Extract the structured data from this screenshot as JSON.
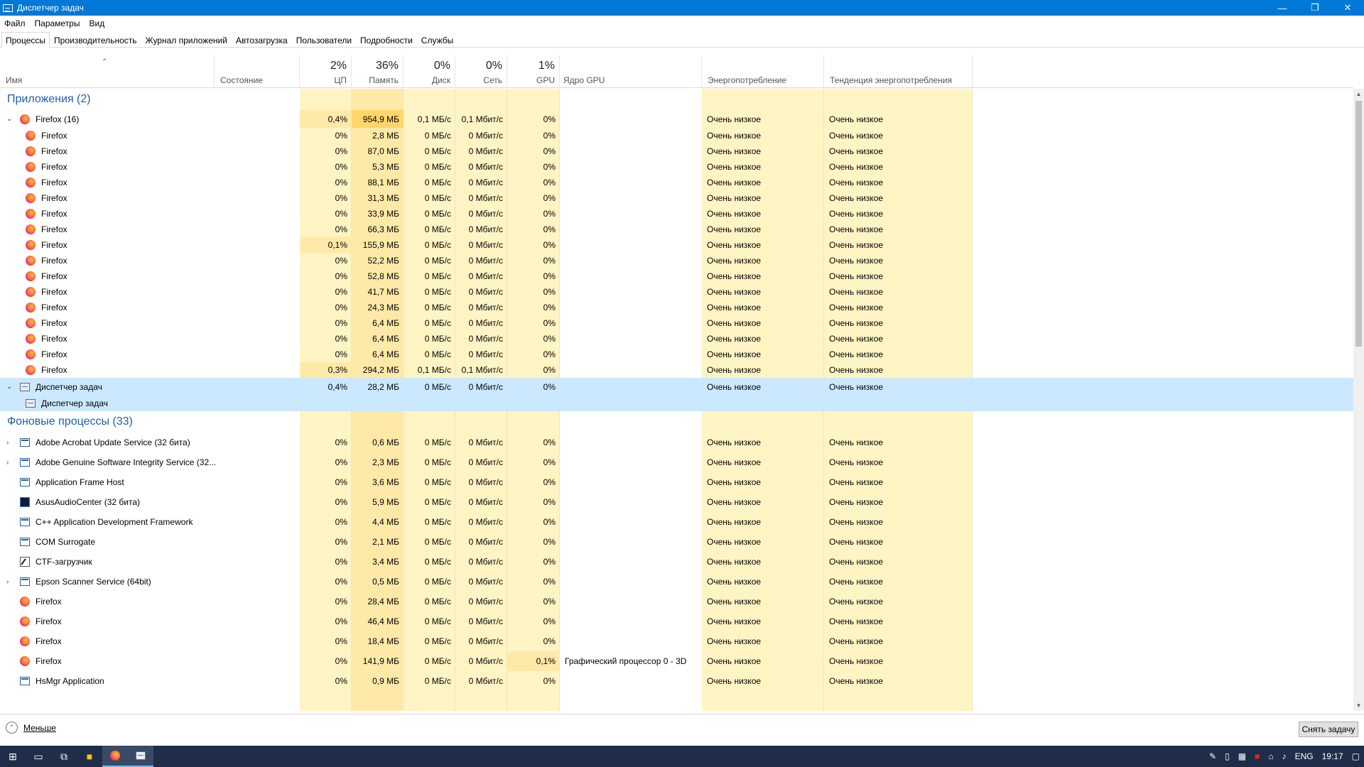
{
  "window": {
    "title": "Диспетчер задач"
  },
  "window_controls": {
    "minimize": "—",
    "restore": "❐",
    "close": "✕"
  },
  "menu": [
    "Файл",
    "Параметры",
    "Вид"
  ],
  "tabs": [
    "Процессы",
    "Производительность",
    "Журнал приложений",
    "Автозагрузка",
    "Пользователи",
    "Подробности",
    "Службы"
  ],
  "active_tab": 0,
  "columns": {
    "name": "Имя",
    "status": "Состояние",
    "cpu": {
      "pct": "2%",
      "label": "ЦП"
    },
    "memory": {
      "pct": "36%",
      "label": "Память"
    },
    "disk": {
      "pct": "0%",
      "label": "Диск"
    },
    "network": {
      "pct": "0%",
      "label": "Сеть"
    },
    "gpu": {
      "pct": "1%",
      "label": "GPU"
    },
    "gpu_engine": "Ядро GPU",
    "power": "Энергопотребление",
    "power_trend": "Тенденция энергопотребления"
  },
  "groups": {
    "apps": "Приложения (2)",
    "background": "Фоновые процессы (33)"
  },
  "rows": [
    {
      "kind": "group",
      "label": "Приложения (2)"
    },
    {
      "kind": "parent",
      "expander": "⌄",
      "icon": "firefox-icon",
      "name": "Firefox (16)",
      "cpu": "0,4%",
      "mem": "954,9 МБ",
      "disk": "0,1 МБ/с",
      "net": "0,1 Мбит/с",
      "gpu": "0%",
      "engine": "",
      "power": "Очень низкое",
      "trend": "Очень низкое",
      "memhl": "strong"
    },
    {
      "kind": "child",
      "icon": "firefox-icon",
      "name": "Firefox",
      "cpu": "0%",
      "mem": "2,8 МБ",
      "disk": "0 МБ/с",
      "net": "0 Мбит/с",
      "gpu": "0%",
      "engine": "",
      "power": "Очень низкое",
      "trend": "Очень низкое"
    },
    {
      "kind": "child",
      "icon": "firefox-icon",
      "name": "Firefox",
      "cpu": "0%",
      "mem": "87,0 МБ",
      "disk": "0 МБ/с",
      "net": "0 Мбит/с",
      "gpu": "0%",
      "engine": "",
      "power": "Очень низкое",
      "trend": "Очень низкое"
    },
    {
      "kind": "child",
      "icon": "firefox-icon",
      "name": "Firefox",
      "cpu": "0%",
      "mem": "5,3 МБ",
      "disk": "0 МБ/с",
      "net": "0 Мбит/с",
      "gpu": "0%",
      "engine": "",
      "power": "Очень низкое",
      "trend": "Очень низкое"
    },
    {
      "kind": "child",
      "icon": "firefox-icon",
      "name": "Firefox",
      "cpu": "0%",
      "mem": "88,1 МБ",
      "disk": "0 МБ/с",
      "net": "0 Мбит/с",
      "gpu": "0%",
      "engine": "",
      "power": "Очень низкое",
      "trend": "Очень низкое"
    },
    {
      "kind": "child",
      "icon": "firefox-icon",
      "name": "Firefox",
      "cpu": "0%",
      "mem": "31,3 МБ",
      "disk": "0 МБ/с",
      "net": "0 Мбит/с",
      "gpu": "0%",
      "engine": "",
      "power": "Очень низкое",
      "trend": "Очень низкое"
    },
    {
      "kind": "child",
      "icon": "firefox-icon",
      "name": "Firefox",
      "cpu": "0%",
      "mem": "33,9 МБ",
      "disk": "0 МБ/с",
      "net": "0 Мбит/с",
      "gpu": "0%",
      "engine": "",
      "power": "Очень низкое",
      "trend": "Очень низкое"
    },
    {
      "kind": "child",
      "icon": "firefox-icon",
      "name": "Firefox",
      "cpu": "0%",
      "mem": "66,3 МБ",
      "disk": "0 МБ/с",
      "net": "0 Мбит/с",
      "gpu": "0%",
      "engine": "",
      "power": "Очень низкое",
      "trend": "Очень низкое"
    },
    {
      "kind": "child",
      "icon": "firefox-icon",
      "name": "Firefox",
      "cpu": "0,1%",
      "mem": "155,9 МБ",
      "disk": "0 МБ/с",
      "net": "0 Мбит/с",
      "gpu": "0%",
      "engine": "",
      "power": "Очень низкое",
      "trend": "Очень низкое",
      "cpuhl": "mid"
    },
    {
      "kind": "child",
      "icon": "firefox-icon",
      "name": "Firefox",
      "cpu": "0%",
      "mem": "52,2 МБ",
      "disk": "0 МБ/с",
      "net": "0 Мбит/с",
      "gpu": "0%",
      "engine": "",
      "power": "Очень низкое",
      "trend": "Очень низкое"
    },
    {
      "kind": "child",
      "icon": "firefox-icon",
      "name": "Firefox",
      "cpu": "0%",
      "mem": "52,8 МБ",
      "disk": "0 МБ/с",
      "net": "0 Мбит/с",
      "gpu": "0%",
      "engine": "",
      "power": "Очень низкое",
      "trend": "Очень низкое"
    },
    {
      "kind": "child",
      "icon": "firefox-icon",
      "name": "Firefox",
      "cpu": "0%",
      "mem": "41,7 МБ",
      "disk": "0 МБ/с",
      "net": "0 Мбит/с",
      "gpu": "0%",
      "engine": "",
      "power": "Очень низкое",
      "trend": "Очень низкое"
    },
    {
      "kind": "child",
      "icon": "firefox-icon",
      "name": "Firefox",
      "cpu": "0%",
      "mem": "24,3 МБ",
      "disk": "0 МБ/с",
      "net": "0 Мбит/с",
      "gpu": "0%",
      "engine": "",
      "power": "Очень низкое",
      "trend": "Очень низкое"
    },
    {
      "kind": "child",
      "icon": "firefox-icon",
      "name": "Firefox",
      "cpu": "0%",
      "mem": "6,4 МБ",
      "disk": "0 МБ/с",
      "net": "0 Мбит/с",
      "gpu": "0%",
      "engine": "",
      "power": "Очень низкое",
      "trend": "Очень низкое"
    },
    {
      "kind": "child",
      "icon": "firefox-icon",
      "name": "Firefox",
      "cpu": "0%",
      "mem": "6,4 МБ",
      "disk": "0 МБ/с",
      "net": "0 Мбит/с",
      "gpu": "0%",
      "engine": "",
      "power": "Очень низкое",
      "trend": "Очень низкое"
    },
    {
      "kind": "child",
      "icon": "firefox-icon",
      "name": "Firefox",
      "cpu": "0%",
      "mem": "6,4 МБ",
      "disk": "0 МБ/с",
      "net": "0 Мбит/с",
      "gpu": "0%",
      "engine": "",
      "power": "Очень низкое",
      "trend": "Очень низкое"
    },
    {
      "kind": "child",
      "icon": "firefox-icon",
      "name": "Firefox",
      "cpu": "0,3%",
      "mem": "294,2 МБ",
      "disk": "0,1 МБ/с",
      "net": "0,1 Мбит/с",
      "gpu": "0%",
      "engine": "",
      "power": "Очень низкое",
      "trend": "Очень низкое",
      "cpuhl": "mid"
    },
    {
      "kind": "parent",
      "selected": true,
      "expander": "⌄",
      "icon": "taskmgr-icon",
      "name": "Диспетчер задач",
      "cpu": "0,4%",
      "mem": "28,2 МБ",
      "disk": "0 МБ/с",
      "net": "0 Мбит/с",
      "gpu": "0%",
      "engine": "",
      "power": "Очень низкое",
      "trend": "Очень низкое"
    },
    {
      "kind": "child",
      "selected": true,
      "icon": "taskmgr-icon",
      "name": "Диспетчер задач",
      "cpu": "",
      "mem": "",
      "disk": "",
      "net": "",
      "gpu": "",
      "engine": "",
      "power": "",
      "trend": ""
    },
    {
      "kind": "group",
      "label": "Фоновые процессы (33)"
    },
    {
      "kind": "bg",
      "expander": "›",
      "icon": "service-icon",
      "name": "Adobe Acrobat Update Service (32 бита)",
      "cpu": "0%",
      "mem": "0,6 МБ",
      "disk": "0 МБ/с",
      "net": "0 Мбит/с",
      "gpu": "0%",
      "engine": "",
      "power": "Очень низкое",
      "trend": "Очень низкое"
    },
    {
      "kind": "bg",
      "expander": "›",
      "icon": "service-icon",
      "name": "Adobe Genuine Software Integrity Service (32...",
      "cpu": "0%",
      "mem": "2,3 МБ",
      "disk": "0 МБ/с",
      "net": "0 Мбит/с",
      "gpu": "0%",
      "engine": "",
      "power": "Очень низкое",
      "trend": "Очень низкое"
    },
    {
      "kind": "bg",
      "icon": "service-icon",
      "name": "Application Frame Host",
      "cpu": "0%",
      "mem": "3,6 МБ",
      "disk": "0 МБ/с",
      "net": "0 Мбит/с",
      "gpu": "0%",
      "engine": "",
      "power": "Очень низкое",
      "trend": "Очень низкое"
    },
    {
      "kind": "bg",
      "icon": "asus-audio-icon",
      "name": "AsusAudioCenter (32 бита)",
      "cpu": "0%",
      "mem": "5,9 МБ",
      "disk": "0 МБ/с",
      "net": "0 Мбит/с",
      "gpu": "0%",
      "engine": "",
      "power": "Очень низкое",
      "trend": "Очень низкое"
    },
    {
      "kind": "bg",
      "icon": "service-icon",
      "name": "C++ Application Development Framework",
      "cpu": "0%",
      "mem": "4,4 МБ",
      "disk": "0 МБ/с",
      "net": "0 Мбит/с",
      "gpu": "0%",
      "engine": "",
      "power": "Очень низкое",
      "trend": "Очень низкое"
    },
    {
      "kind": "bg",
      "icon": "service-icon",
      "name": "COM Surrogate",
      "cpu": "0%",
      "mem": "2,1 МБ",
      "disk": "0 МБ/с",
      "net": "0 Мбит/с",
      "gpu": "0%",
      "engine": "",
      "power": "Очень низкое",
      "trend": "Очень низкое"
    },
    {
      "kind": "bg",
      "icon": "ctf-icon",
      "name": "CTF-загрузчик",
      "cpu": "0%",
      "mem": "3,4 МБ",
      "disk": "0 МБ/с",
      "net": "0 Мбит/с",
      "gpu": "0%",
      "engine": "",
      "power": "Очень низкое",
      "trend": "Очень низкое"
    },
    {
      "kind": "bg",
      "expander": "›",
      "icon": "service-icon",
      "name": "Epson Scanner Service (64bit)",
      "cpu": "0%",
      "mem": "0,5 МБ",
      "disk": "0 МБ/с",
      "net": "0 Мбит/с",
      "gpu": "0%",
      "engine": "",
      "power": "Очень низкое",
      "trend": "Очень низкое"
    },
    {
      "kind": "bg",
      "icon": "firefox-icon",
      "name": "Firefox",
      "cpu": "0%",
      "mem": "28,4 МБ",
      "disk": "0 МБ/с",
      "net": "0 Мбит/с",
      "gpu": "0%",
      "engine": "",
      "power": "Очень низкое",
      "trend": "Очень низкое"
    },
    {
      "kind": "bg",
      "icon": "firefox-icon",
      "name": "Firefox",
      "cpu": "0%",
      "mem": "46,4 МБ",
      "disk": "0 МБ/с",
      "net": "0 Мбит/с",
      "gpu": "0%",
      "engine": "",
      "power": "Очень низкое",
      "trend": "Очень низкое"
    },
    {
      "kind": "bg",
      "icon": "firefox-icon",
      "name": "Firefox",
      "cpu": "0%",
      "mem": "18,4 МБ",
      "disk": "0 МБ/с",
      "net": "0 Мбит/с",
      "gpu": "0%",
      "engine": "",
      "power": "Очень низкое",
      "trend": "Очень низкое"
    },
    {
      "kind": "bg",
      "icon": "firefox-icon",
      "name": "Firefox",
      "cpu": "0%",
      "mem": "141,9 МБ",
      "disk": "0 МБ/с",
      "net": "0 Мбит/с",
      "gpu": "0,1%",
      "engine": "Графический процессор 0 - 3D",
      "power": "Очень низкое",
      "trend": "Очень низкое",
      "gpuhl": "mid"
    },
    {
      "kind": "bg",
      "icon": "service-icon",
      "name": "HsMgr Application",
      "cpu": "0%",
      "mem": "0,9 МБ",
      "disk": "0 МБ/с",
      "net": "0 Мбит/с",
      "gpu": "0%",
      "engine": "",
      "power": "Очень низкое",
      "trend": "Очень низкое"
    }
  ],
  "footer": {
    "less": "Меньше",
    "end_task": "Снять задачу"
  },
  "taskbar": {
    "lang": "ENG",
    "time": "19:17"
  },
  "colors": {
    "titlebar": "#0078d7",
    "heat_low": "#fff4c4",
    "heat_mid": "#ffe9a8",
    "heat_high": "#ffd66b",
    "selection": "#cce8ff",
    "group_text": "#1e5fb0"
  }
}
